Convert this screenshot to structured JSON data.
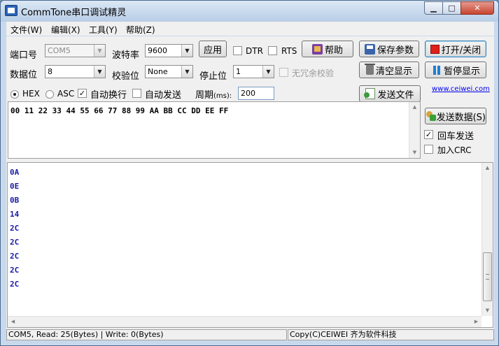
{
  "window": {
    "title": "CommTone串口调试精灵"
  },
  "menu": [
    {
      "label": "文件(W)"
    },
    {
      "label": "编辑(X)"
    },
    {
      "label": "工具(Y)"
    },
    {
      "label": "帮助(Z)"
    }
  ],
  "port": {
    "label": "端口号",
    "value": "COM5"
  },
  "baud": {
    "label": "波特率",
    "value": "9600"
  },
  "databits": {
    "label": "数据位",
    "value": "8"
  },
  "parity": {
    "label": "校验位",
    "value": "None"
  },
  "stopbits": {
    "label": "停止位",
    "value": "1"
  },
  "buttons": {
    "apply": "应用",
    "help": "帮助",
    "save_params": "保存参数",
    "open_close": "打开/关闭",
    "clear_display": "清空显示",
    "pause_display": "暂停显示",
    "send_file": "发送文件",
    "send_data": "发送数据(S)"
  },
  "checks": {
    "dtr": {
      "label": "DTR",
      "checked": false
    },
    "rts": {
      "label": "RTS",
      "checked": false
    },
    "no_redundant": {
      "label": "无冗余校验",
      "checked": false
    },
    "auto_newline": {
      "label": "自动换行",
      "checked": true
    },
    "auto_send": {
      "label": "自动发送",
      "checked": false
    },
    "cr_send": {
      "label": "回车发送",
      "checked": true
    },
    "add_crc": {
      "label": "加入CRC",
      "checked": false
    }
  },
  "mode": {
    "hex": {
      "label": "HEX",
      "selected": true
    },
    "asc": {
      "label": "ASC",
      "selected": false
    }
  },
  "period": {
    "label": "周期",
    "unit": "(ms):",
    "value": "200"
  },
  "link": "www.ceiwei.com",
  "send_text": "00 11 22 33 44 55 66 77 88 99 AA BB CC DD EE FF",
  "received": [
    "0A",
    "0E",
    "0B",
    "14",
    "2C",
    "2C",
    "2C",
    "2C",
    "2C"
  ],
  "status": {
    "left": "COM5, Read: 25(Bytes) | Write: 0(Bytes)",
    "right": "Copy(C)CEIWEI 齐为软件科技"
  }
}
